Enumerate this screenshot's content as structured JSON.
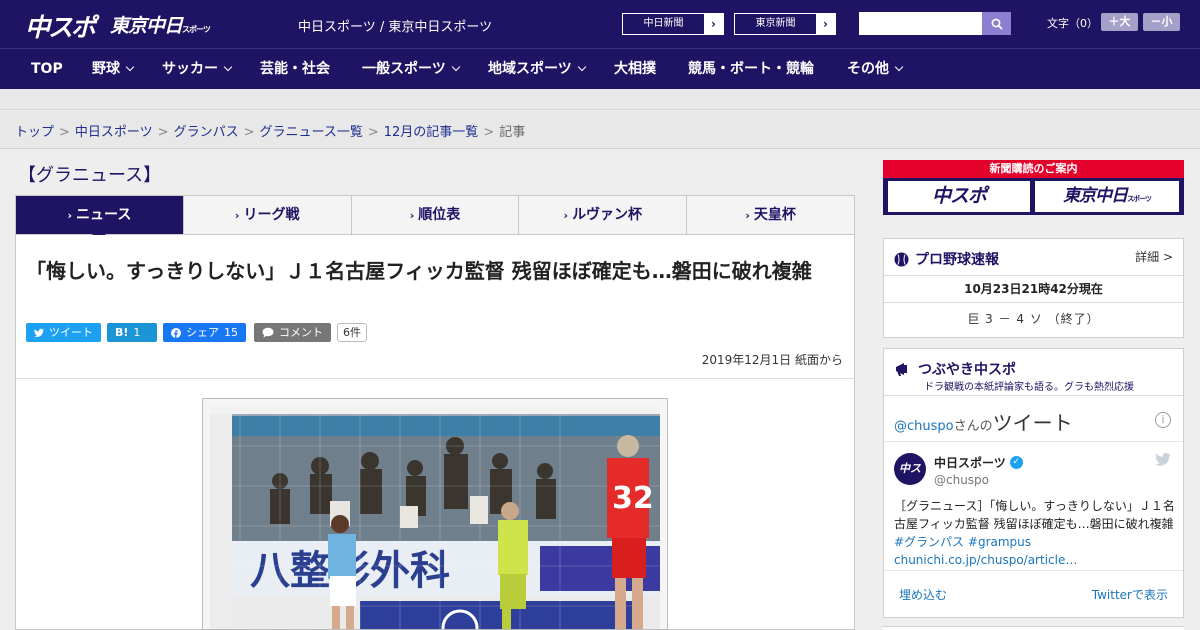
{
  "header": {
    "logo_chuspo": "中スポ",
    "logo_tokyo": "東京中日",
    "logo_tokyo_small": "スポーツ",
    "site_name": "中日スポーツ / 東京中日スポーツ",
    "btn_chunichi": "中日新聞",
    "btn_tokyo": "東京新聞",
    "arrow": "›",
    "search_placeholder": "",
    "fontsize_label": "文字（0）",
    "fontsize_up": "＋大",
    "fontsize_down": "－小"
  },
  "nav": {
    "items": [
      {
        "label": "TOP",
        "dropdown": false
      },
      {
        "label": "野球",
        "dropdown": true
      },
      {
        "label": "サッカー",
        "dropdown": true
      },
      {
        "label": "芸能・社会",
        "dropdown": false
      },
      {
        "label": "一般スポーツ",
        "dropdown": true
      },
      {
        "label": "地域スポーツ",
        "dropdown": true
      },
      {
        "label": "大相撲",
        "dropdown": false
      },
      {
        "label": "競馬・ボート・競輪",
        "dropdown": false
      },
      {
        "label": "その他",
        "dropdown": true
      }
    ]
  },
  "breadcrumb": {
    "items": [
      "トップ",
      "中日スポーツ",
      "グランパス",
      "グラニュース一覧",
      "12月の記事一覧"
    ],
    "current": "記事",
    "sep": ">"
  },
  "section_title": "【グラニュース】",
  "tabs": [
    {
      "label": "ニュース",
      "active": true
    },
    {
      "label": "リーグ戦",
      "active": false
    },
    {
      "label": "順位表",
      "active": false
    },
    {
      "label": "ルヴァン杯",
      "active": false
    },
    {
      "label": "天皇杯",
      "active": false
    }
  ],
  "tab_marker": "›",
  "article": {
    "headline": "「悔しい。すっきりしない」Ｊ１名古屋フィッカ監督 残留ほぼ確定も…磐田に破れ複雑",
    "share_tweet": "ツイート",
    "share_hatena": "B!",
    "share_hatena_count": "1",
    "share_fb": "シェア",
    "share_fb_count": "15",
    "share_comment": "コメント",
    "comment_count": "6件",
    "date": "2019年12月1日 紙面から"
  },
  "sidebar": {
    "subscribe": {
      "title": "新聞購読のご案内",
      "btn1": "中スポ",
      "btn2": "東京中日",
      "btn2_small": "スポーツ"
    },
    "pro_baseball": {
      "title": "プロ野球速報",
      "detail": "詳細 >",
      "time": "10月23日21時42分現在",
      "score": "巨 3 － 4 ソ （終了）"
    },
    "tweets": {
      "title": "つぶやき中スポ",
      "subtitle": "ドラ観戦の本紙評論家も語る。グラも熱烈応援",
      "handle_link": "@chuspo",
      "handle_suffix": "さんの",
      "handle_big": "ツイート",
      "info": "i",
      "avatar_text": "中スポ",
      "user_name": "中日スポーツ",
      "verified": "✓",
      "user_handle": "@chuspo",
      "text_main": "［グラニュース］「悔しい。すっきりしない」Ｊ１名古屋フィッカ監督 残留ほぼ確定も…磐田に破れ複雑",
      "text_hashtag1": "#グランパス",
      "text_hashtag2": "#grampus",
      "text_link": "chunichi.co.jp/chuspo/article…",
      "embed": "埋め込む",
      "view_on_twitter": "Twitterで表示"
    }
  },
  "photo": {
    "jersey_number": "32"
  },
  "colors": {
    "brand_navy": "#1f1464",
    "accent_red": "#e3002b",
    "twitter_blue": "#1da1f2",
    "facebook_blue": "#1877f2",
    "hatena_blue": "#1b95d6",
    "link_blue": "#1b75bb"
  }
}
